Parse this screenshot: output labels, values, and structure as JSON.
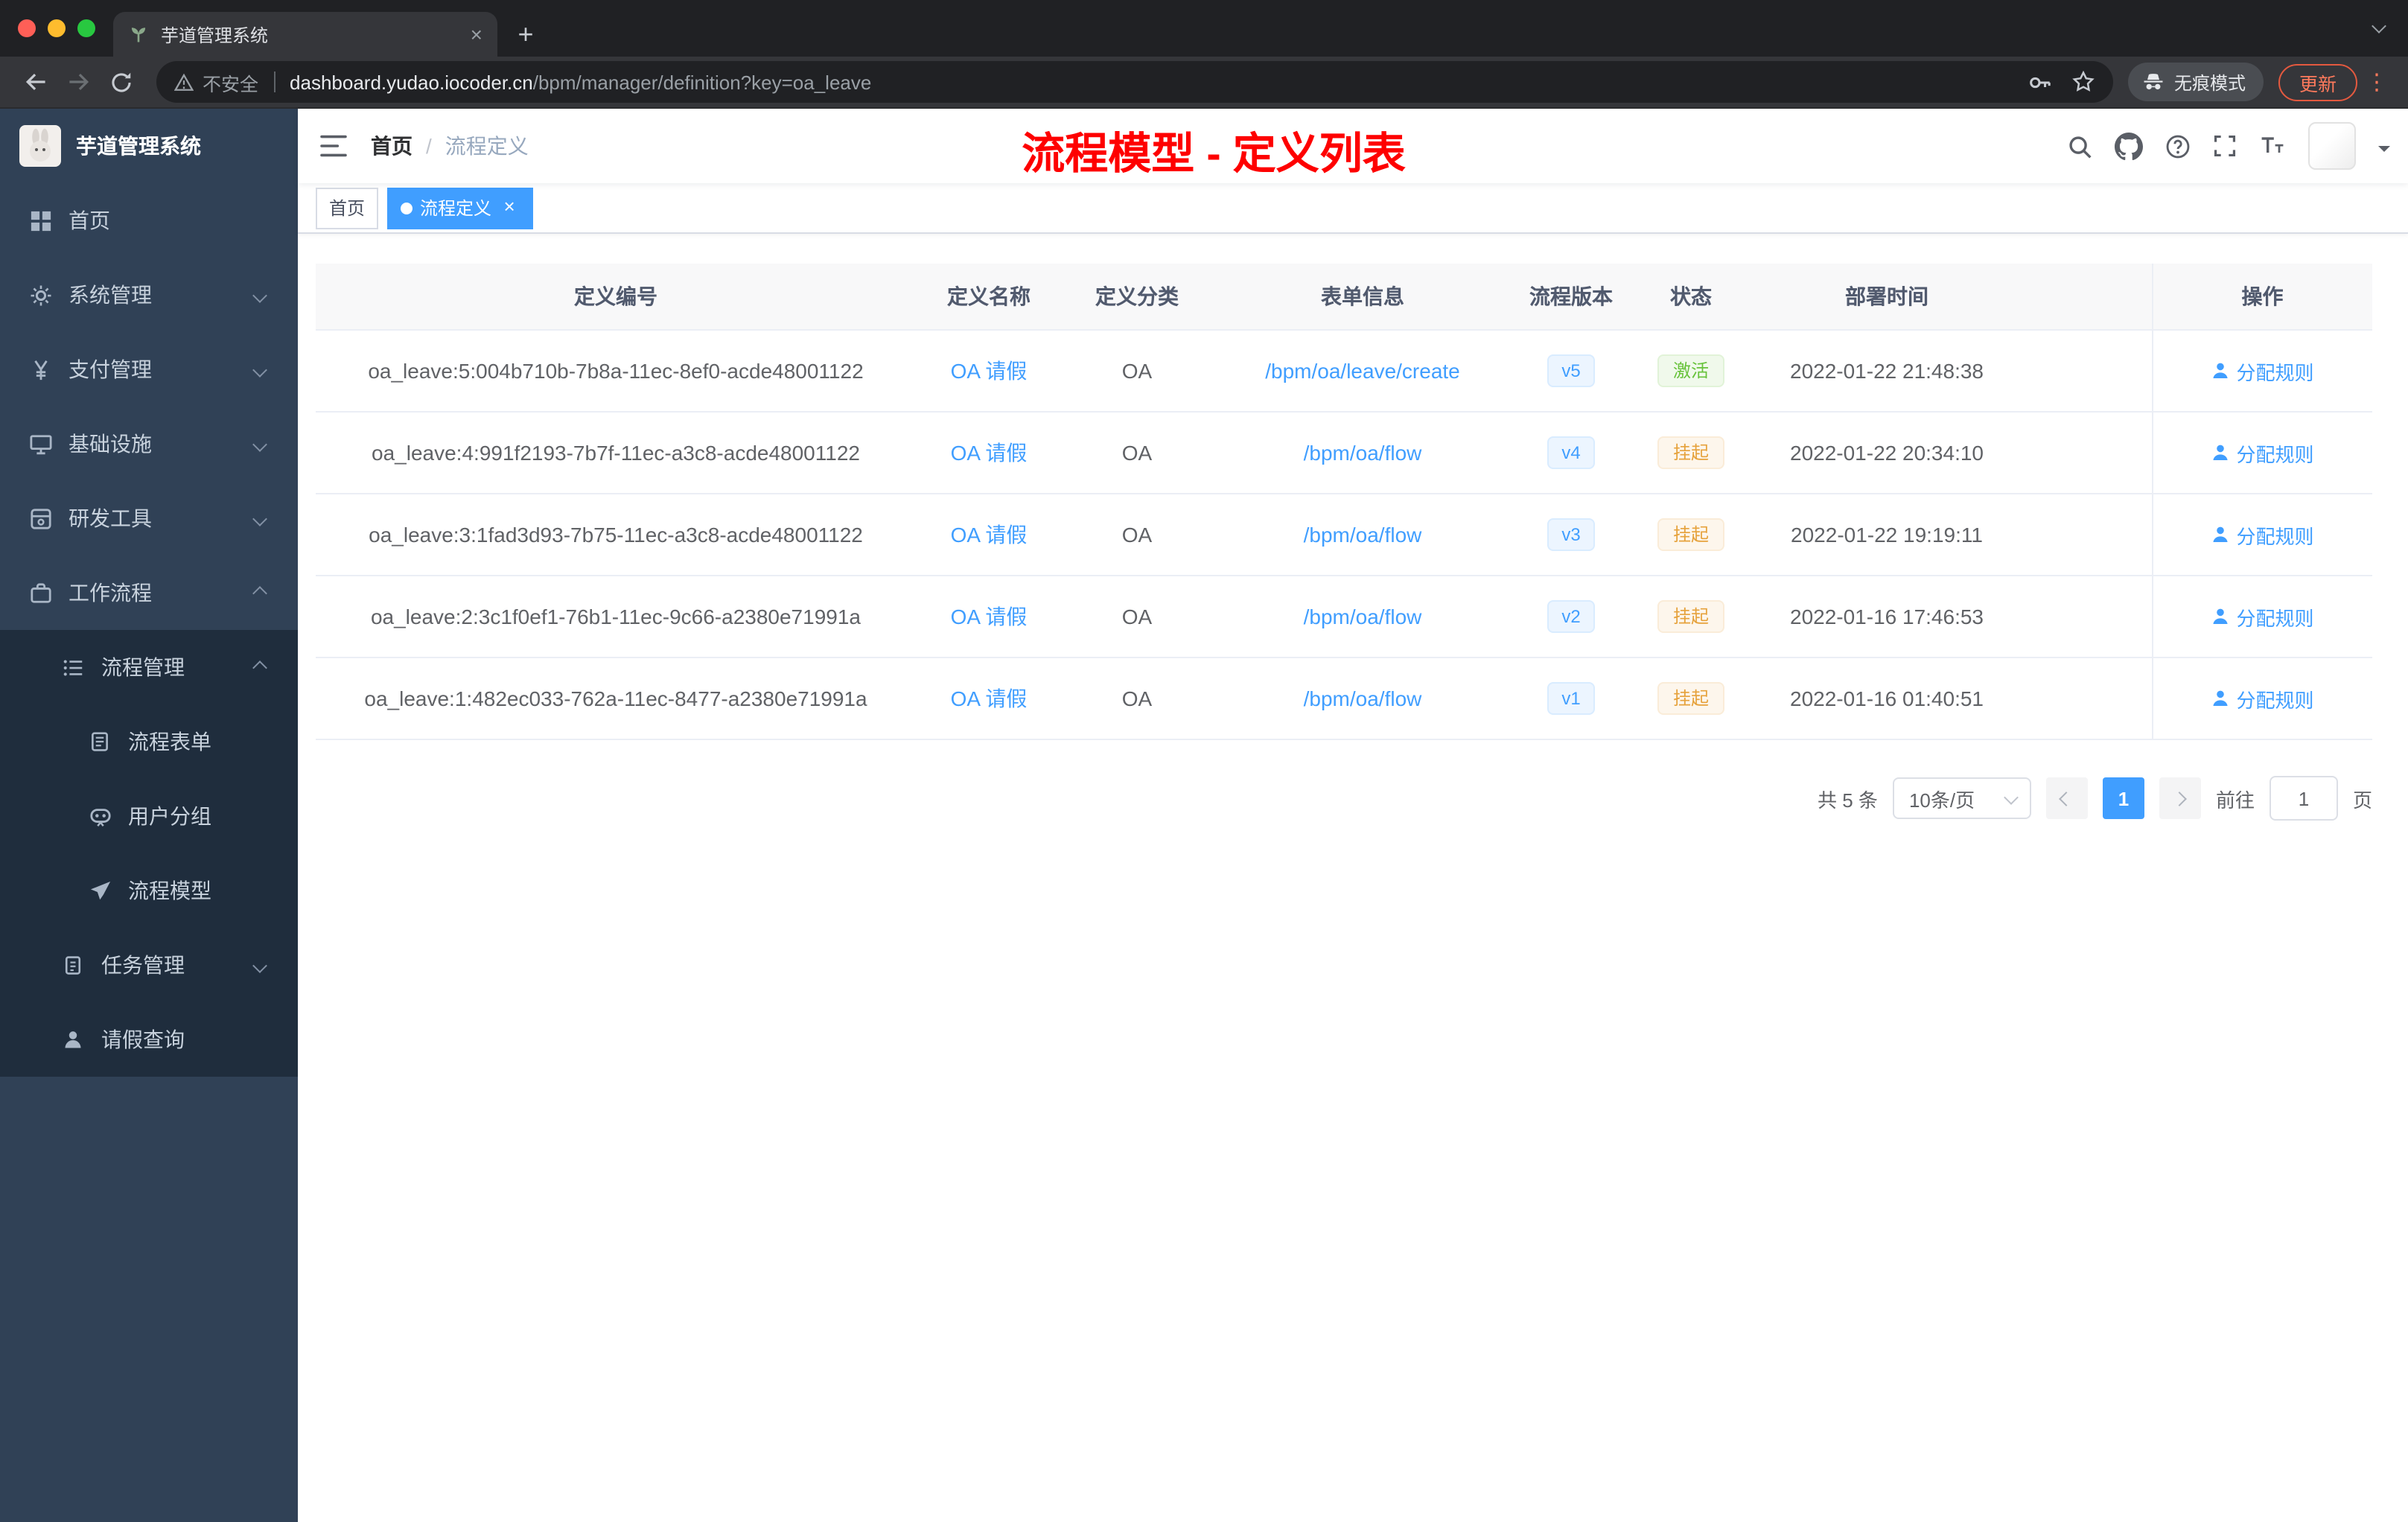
{
  "colors": {
    "accent": "#409eff",
    "success": "#67c23a",
    "warning": "#e6a23c",
    "annotation_red": "#fe0000",
    "sidebar_bg": "#304156",
    "sidebar_submenu_bg": "#1f2d3d",
    "chrome_dark": "#202124",
    "chrome_toolbar": "#35363a"
  },
  "icons": {
    "close": "×",
    "new_tab": "+",
    "kebab": "⋮"
  },
  "browser": {
    "tab_title": "芋道管理系统",
    "security_label": "不安全",
    "url_host": "dashboard.yudao.iocoder.cn",
    "url_path": "/bpm/manager/definition?key=oa_leave",
    "incognito_label": "无痕模式",
    "update_label": "更新"
  },
  "sidebar": {
    "logo_title": "芋道管理系统",
    "menu": [
      {
        "label": "首页"
      },
      {
        "label": "系统管理"
      },
      {
        "label": "支付管理"
      },
      {
        "label": "基础设施"
      },
      {
        "label": "研发工具"
      },
      {
        "label": "工作流程"
      },
      {
        "label": "流程管理"
      },
      {
        "label": "流程表单"
      },
      {
        "label": "用户分组"
      },
      {
        "label": "流程模型"
      },
      {
        "label": "任务管理"
      },
      {
        "label": "请假查询"
      }
    ]
  },
  "header": {
    "breadcrumb_home": "首页",
    "breadcrumb_separator": "/",
    "breadcrumb_current": "流程定义",
    "overlay_title": "流程模型 - 定义列表"
  },
  "tags_view": {
    "tabs": [
      {
        "label": "首页",
        "active": false
      },
      {
        "label": "流程定义",
        "active": true
      }
    ]
  },
  "table": {
    "columns": [
      "定义编号",
      "定义名称",
      "定义分类",
      "表单信息",
      "流程版本",
      "状态",
      "部署时间",
      "操作"
    ],
    "rows": [
      {
        "id": "oa_leave:5:004b710b-7b8a-11ec-8ef0-acde48001122",
        "name": "OA 请假",
        "category": "OA",
        "form": "/bpm/oa/leave/create",
        "version": "v5",
        "status": "激活",
        "status_type": "success",
        "time": "2022-01-22 21:48:38",
        "action": "分配规则"
      },
      {
        "id": "oa_leave:4:991f2193-7b7f-11ec-a3c8-acde48001122",
        "name": "OA 请假",
        "category": "OA",
        "form": "/bpm/oa/flow",
        "version": "v4",
        "status": "挂起",
        "status_type": "warning",
        "time": "2022-01-22 20:34:10",
        "action": "分配规则"
      },
      {
        "id": "oa_leave:3:1fad3d93-7b75-11ec-a3c8-acde48001122",
        "name": "OA 请假",
        "category": "OA",
        "form": "/bpm/oa/flow",
        "version": "v3",
        "status": "挂起",
        "status_type": "warning",
        "time": "2022-01-22 19:19:11",
        "action": "分配规则"
      },
      {
        "id": "oa_leave:2:3c1f0ef1-76b1-11ec-9c66-a2380e71991a",
        "name": "OA 请假",
        "category": "OA",
        "form": "/bpm/oa/flow",
        "version": "v2",
        "status": "挂起",
        "status_type": "warning",
        "time": "2022-01-16 17:46:53",
        "action": "分配规则"
      },
      {
        "id": "oa_leave:1:482ec033-762a-11ec-8477-a2380e71991a",
        "name": "OA 请假",
        "category": "OA",
        "form": "/bpm/oa/flow",
        "version": "v1",
        "status": "挂起",
        "status_type": "warning",
        "time": "2022-01-16 01:40:51",
        "action": "分配规则"
      }
    ]
  },
  "pagination": {
    "total": "共 5 条",
    "page_size": "10条/页",
    "current_page": "1",
    "goto_label": "前往",
    "goto_value": "1",
    "page_unit": "页"
  }
}
